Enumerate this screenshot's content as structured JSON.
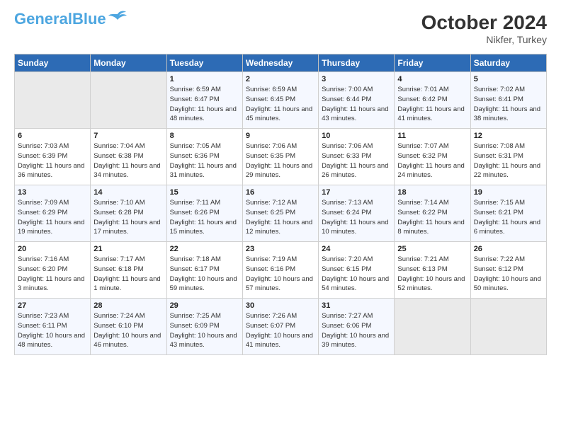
{
  "header": {
    "logo_main": "General",
    "logo_accent": "Blue",
    "month": "October 2024",
    "location": "Nikfer, Turkey"
  },
  "weekdays": [
    "Sunday",
    "Monday",
    "Tuesday",
    "Wednesday",
    "Thursday",
    "Friday",
    "Saturday"
  ],
  "weeks": [
    [
      {
        "day": "",
        "empty": true
      },
      {
        "day": "",
        "empty": true
      },
      {
        "day": "1",
        "sunrise": "6:59 AM",
        "sunset": "6:47 PM",
        "daylight": "11 hours and 48 minutes."
      },
      {
        "day": "2",
        "sunrise": "6:59 AM",
        "sunset": "6:45 PM",
        "daylight": "11 hours and 45 minutes."
      },
      {
        "day": "3",
        "sunrise": "7:00 AM",
        "sunset": "6:44 PM",
        "daylight": "11 hours and 43 minutes."
      },
      {
        "day": "4",
        "sunrise": "7:01 AM",
        "sunset": "6:42 PM",
        "daylight": "11 hours and 41 minutes."
      },
      {
        "day": "5",
        "sunrise": "7:02 AM",
        "sunset": "6:41 PM",
        "daylight": "11 hours and 38 minutes."
      }
    ],
    [
      {
        "day": "6",
        "sunrise": "7:03 AM",
        "sunset": "6:39 PM",
        "daylight": "11 hours and 36 minutes."
      },
      {
        "day": "7",
        "sunrise": "7:04 AM",
        "sunset": "6:38 PM",
        "daylight": "11 hours and 34 minutes."
      },
      {
        "day": "8",
        "sunrise": "7:05 AM",
        "sunset": "6:36 PM",
        "daylight": "11 hours and 31 minutes."
      },
      {
        "day": "9",
        "sunrise": "7:06 AM",
        "sunset": "6:35 PM",
        "daylight": "11 hours and 29 minutes."
      },
      {
        "day": "10",
        "sunrise": "7:06 AM",
        "sunset": "6:33 PM",
        "daylight": "11 hours and 26 minutes."
      },
      {
        "day": "11",
        "sunrise": "7:07 AM",
        "sunset": "6:32 PM",
        "daylight": "11 hours and 24 minutes."
      },
      {
        "day": "12",
        "sunrise": "7:08 AM",
        "sunset": "6:31 PM",
        "daylight": "11 hours and 22 minutes."
      }
    ],
    [
      {
        "day": "13",
        "sunrise": "7:09 AM",
        "sunset": "6:29 PM",
        "daylight": "11 hours and 19 minutes."
      },
      {
        "day": "14",
        "sunrise": "7:10 AM",
        "sunset": "6:28 PM",
        "daylight": "11 hours and 17 minutes."
      },
      {
        "day": "15",
        "sunrise": "7:11 AM",
        "sunset": "6:26 PM",
        "daylight": "11 hours and 15 minutes."
      },
      {
        "day": "16",
        "sunrise": "7:12 AM",
        "sunset": "6:25 PM",
        "daylight": "11 hours and 12 minutes."
      },
      {
        "day": "17",
        "sunrise": "7:13 AM",
        "sunset": "6:24 PM",
        "daylight": "11 hours and 10 minutes."
      },
      {
        "day": "18",
        "sunrise": "7:14 AM",
        "sunset": "6:22 PM",
        "daylight": "11 hours and 8 minutes."
      },
      {
        "day": "19",
        "sunrise": "7:15 AM",
        "sunset": "6:21 PM",
        "daylight": "11 hours and 6 minutes."
      }
    ],
    [
      {
        "day": "20",
        "sunrise": "7:16 AM",
        "sunset": "6:20 PM",
        "daylight": "11 hours and 3 minutes."
      },
      {
        "day": "21",
        "sunrise": "7:17 AM",
        "sunset": "6:18 PM",
        "daylight": "11 hours and 1 minute."
      },
      {
        "day": "22",
        "sunrise": "7:18 AM",
        "sunset": "6:17 PM",
        "daylight": "10 hours and 59 minutes."
      },
      {
        "day": "23",
        "sunrise": "7:19 AM",
        "sunset": "6:16 PM",
        "daylight": "10 hours and 57 minutes."
      },
      {
        "day": "24",
        "sunrise": "7:20 AM",
        "sunset": "6:15 PM",
        "daylight": "10 hours and 54 minutes."
      },
      {
        "day": "25",
        "sunrise": "7:21 AM",
        "sunset": "6:13 PM",
        "daylight": "10 hours and 52 minutes."
      },
      {
        "day": "26",
        "sunrise": "7:22 AM",
        "sunset": "6:12 PM",
        "daylight": "10 hours and 50 minutes."
      }
    ],
    [
      {
        "day": "27",
        "sunrise": "7:23 AM",
        "sunset": "6:11 PM",
        "daylight": "10 hours and 48 minutes."
      },
      {
        "day": "28",
        "sunrise": "7:24 AM",
        "sunset": "6:10 PM",
        "daylight": "10 hours and 46 minutes."
      },
      {
        "day": "29",
        "sunrise": "7:25 AM",
        "sunset": "6:09 PM",
        "daylight": "10 hours and 43 minutes."
      },
      {
        "day": "30",
        "sunrise": "7:26 AM",
        "sunset": "6:07 PM",
        "daylight": "10 hours and 41 minutes."
      },
      {
        "day": "31",
        "sunrise": "7:27 AM",
        "sunset": "6:06 PM",
        "daylight": "10 hours and 39 minutes."
      },
      {
        "day": "",
        "empty": true
      },
      {
        "day": "",
        "empty": true
      }
    ]
  ]
}
